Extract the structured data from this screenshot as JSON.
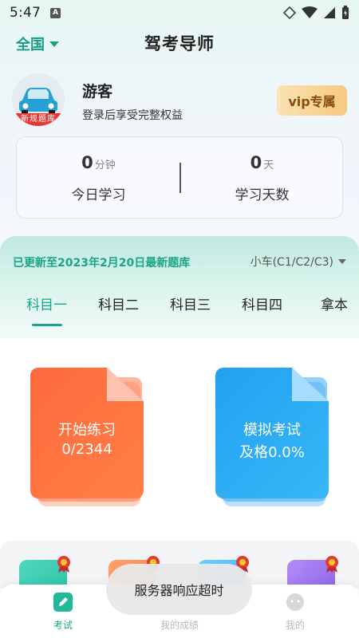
{
  "status_bar": {
    "time": "5:47",
    "indicator": "A"
  },
  "header": {
    "region": "全国",
    "title": "驾考导师"
  },
  "profile": {
    "name": "游客",
    "subtitle": "登录后享受完整权益",
    "avatar_banner": "新规题库",
    "vip_label": "vip专属"
  },
  "stats": {
    "today": {
      "value": "0",
      "unit": "分钟",
      "label": "今日学习"
    },
    "days": {
      "value": "0",
      "unit": "天",
      "label": "学习天数"
    }
  },
  "subjects": {
    "update_notice": "已更新至2023年2月20日最新题库",
    "vehicle": "小车(C1/C2/C3)",
    "tabs": [
      "科目一",
      "科目二",
      "科目三",
      "科目四",
      "拿本"
    ],
    "active_tab": 0
  },
  "cards": {
    "practice": {
      "title": "开始练习",
      "progress": "0/2344",
      "color": "#ff6a3d"
    },
    "exam": {
      "title": "模拟考试",
      "pass_rate": "及格0.0%",
      "color": "#23a1f2"
    }
  },
  "tools": [
    {
      "icon": "teal-tool-icon"
    },
    {
      "icon": "orange-tool-icon"
    },
    {
      "icon": "blue-tool-icon"
    },
    {
      "icon": "purple-tool-icon"
    }
  ],
  "bottom_nav": [
    {
      "label": "考试",
      "icon": "pencil-icon",
      "active": true
    },
    {
      "label": "我的成绩",
      "icon": "score-icon",
      "active": false
    },
    {
      "label": "我的",
      "icon": "profile-icon",
      "active": false
    }
  ],
  "toast": "服务器响应超时",
  "colors": {
    "accent": "#1aa58a",
    "vip_text": "#8a4a10"
  }
}
